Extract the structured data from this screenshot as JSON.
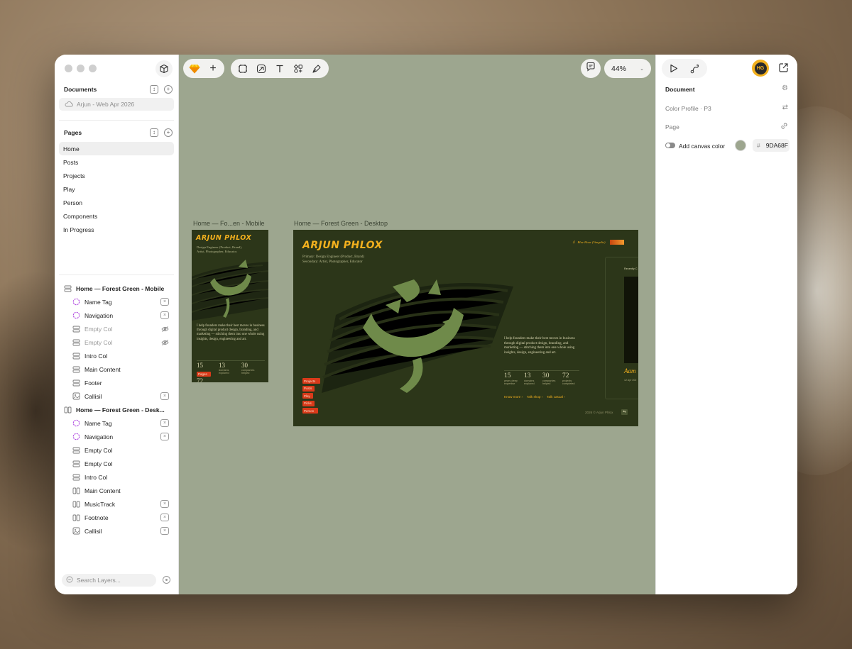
{
  "colors": {
    "canvas": "#9DA68F",
    "frame_bg": "#2C3619",
    "brand_yellow": "#F2B01E",
    "nav_red": "#D93A1A",
    "calligraphy_green": "#6F8A4A"
  },
  "sidebar": {
    "documents_title": "Documents",
    "document_name": "Arjun - Web Apr 2026",
    "pages_title": "Pages",
    "pages": [
      "Home",
      "Posts",
      "Projects",
      "Play",
      "Person",
      "Components",
      "In Progress"
    ],
    "layers": [
      {
        "label": "Home — Forest Green - Mobile",
        "level": "parent",
        "icon": "stack-icon"
      },
      {
        "label": "Name Tag",
        "level": "child",
        "icon": "component-icon",
        "right": "variable-icon"
      },
      {
        "label": "Navigation",
        "level": "child",
        "icon": "component-icon",
        "right": "variable-icon"
      },
      {
        "label": "Empty Col",
        "level": "child",
        "icon": "stack-icon",
        "right": "hidden-icon",
        "dim": true
      },
      {
        "label": "Empty Col",
        "level": "child",
        "icon": "stack-icon",
        "right": "hidden-icon",
        "dim": true
      },
      {
        "label": "Intro Col",
        "level": "child",
        "icon": "stack-icon"
      },
      {
        "label": "Main Content",
        "level": "child",
        "icon": "stack-icon"
      },
      {
        "label": "Footer",
        "level": "child",
        "icon": "stack-icon"
      },
      {
        "label": "Callisil",
        "level": "child",
        "icon": "image-icon",
        "right": "variable-icon"
      },
      {
        "label": "Home — Forest Green - Desk...",
        "level": "parent",
        "icon": "columns-icon"
      },
      {
        "label": "Name Tag",
        "level": "child",
        "icon": "component-icon",
        "right": "variable-icon"
      },
      {
        "label": "Navigation",
        "level": "child",
        "icon": "component-icon",
        "right": "variable-icon"
      },
      {
        "label": "Empty Col",
        "level": "child",
        "icon": "stack-icon"
      },
      {
        "label": "Empty Col",
        "level": "child",
        "icon": "stack-icon"
      },
      {
        "label": "Intro Col",
        "level": "child",
        "icon": "stack-icon"
      },
      {
        "label": "Main Content",
        "level": "child",
        "icon": "columns-icon"
      },
      {
        "label": "MusicTrack",
        "level": "child",
        "icon": "columns-icon",
        "right": "variable-icon"
      },
      {
        "label": "Footnote",
        "level": "child",
        "icon": "columns-icon",
        "right": "variable-icon"
      },
      {
        "label": "Callisil",
        "level": "child",
        "icon": "image-icon",
        "right": "variable-icon"
      }
    ],
    "search_placeholder": "Search Layers..."
  },
  "toolbar": {
    "zoom": "44%"
  },
  "canvas": {
    "mobile_frame": {
      "label": "Home — Fo...en - Mobile",
      "brand": "ARJUN PHLOX",
      "subtitle": "Design Engineer (Product, Brand), Artist, Photographer, Educator.",
      "intro": "I help founders make their best moves in business through digital product design, branding, and marketing — stitching them into one whole using insights, design, engineering and art.",
      "stats": [
        {
          "n": "15",
          "l": ""
        },
        {
          "n": "13",
          "l": "domains explored"
        },
        {
          "n": "30",
          "l": "companies helped"
        }
      ],
      "nav_button": "Pages",
      "cut_text": "72"
    },
    "desktop_frame": {
      "label": "Home — Forest Green - Desktop",
      "brand": "ARJUN PHLOX",
      "subtitle_1": "Primary: Design Engineer (Product, Brand)",
      "subtitle_2": "Secondary: Artist, Photographer, Educator",
      "music_track": "Blue Hour (Vangelis)",
      "intro": "I help founders make their best moves in business through digital product design, branding, and marketing — stitching them into one whole using insights, design, engineering and art.",
      "stats": [
        {
          "n": "15",
          "l": "years deep expertise"
        },
        {
          "n": "13",
          "l": "domains explored"
        },
        {
          "n": "30",
          "l": "companies helped"
        },
        {
          "n": "72",
          "l": "projects completed"
        }
      ],
      "links": [
        "Know more ›",
        "Talk shop ›",
        "Talk casual ›"
      ],
      "nav": [
        "Projects",
        "Posts",
        "Play",
        "Picks",
        "Person"
      ],
      "card_heading": "Recently C",
      "card_title": "Aam",
      "card_date": "12 Apr 202",
      "footer": "2026 © Arjun Phlox"
    }
  },
  "right_panel": {
    "title": "Document",
    "color_profile": "Color Profile · P3",
    "page_label": "Page",
    "canvas_color_label": "Add canvas color",
    "hex_value": "9DA68F",
    "avatar_initials": "HG"
  }
}
